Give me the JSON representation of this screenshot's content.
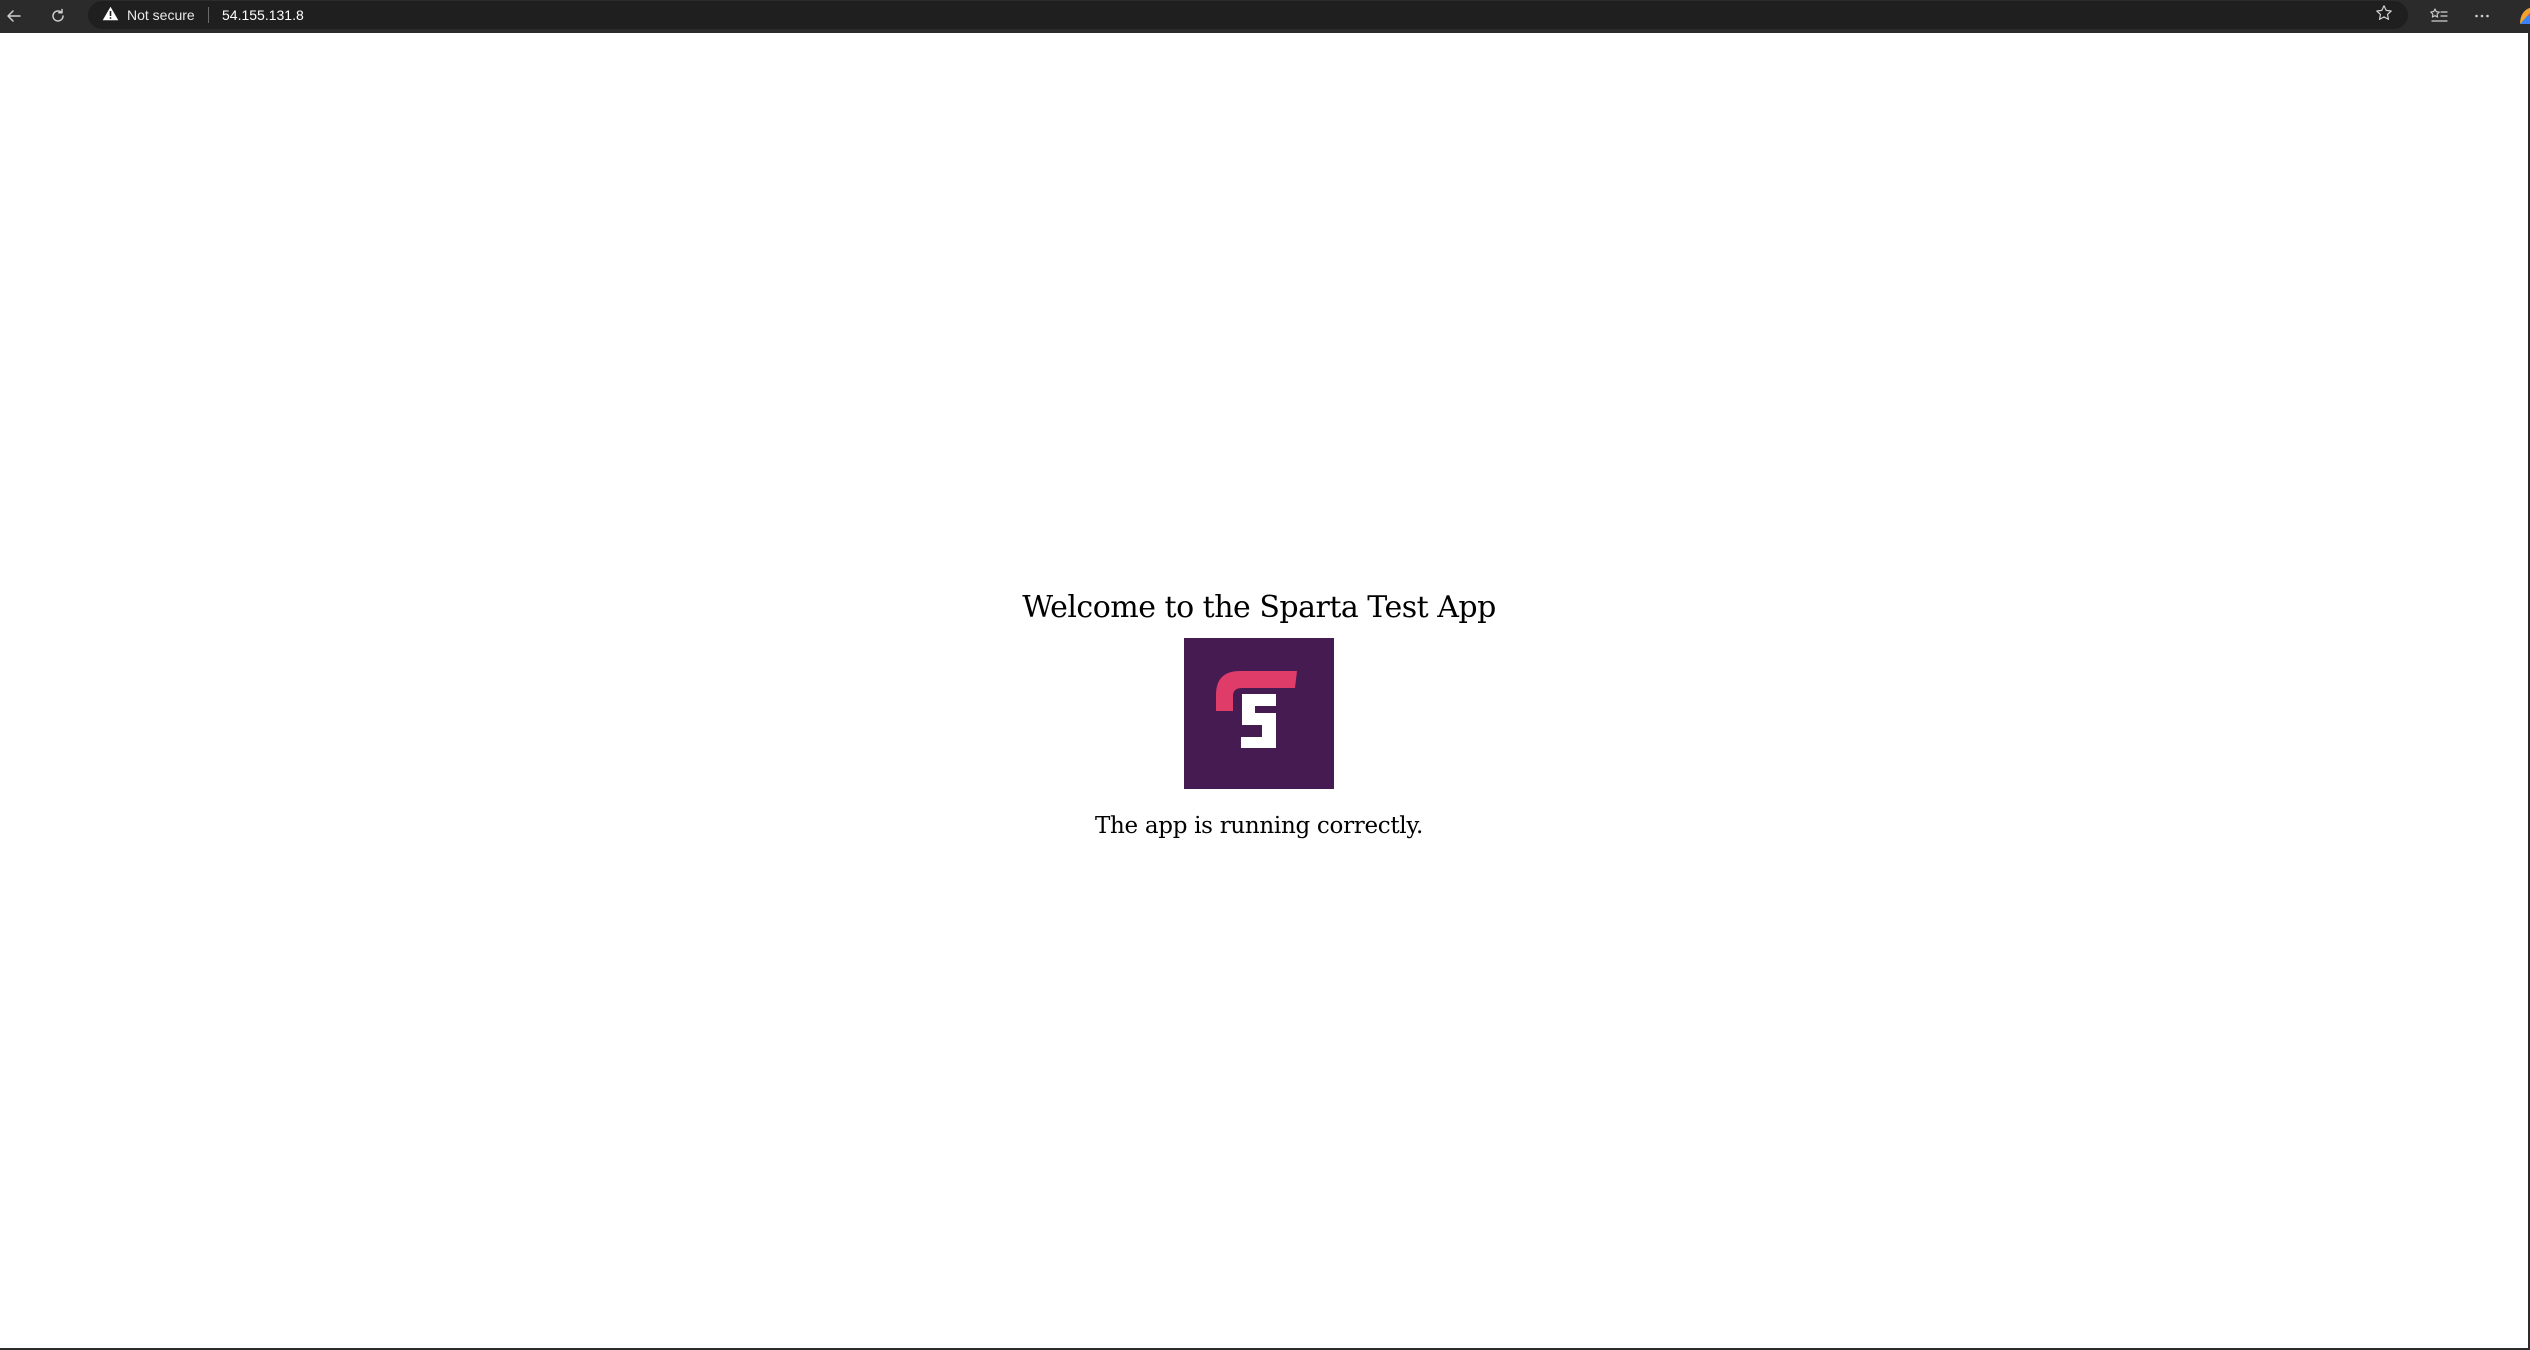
{
  "browser": {
    "security_label": "Not secure",
    "url": "54.155.131.8",
    "icons": {
      "back": "back-arrow-icon",
      "reload": "reload-icon",
      "security": "warning-icon",
      "favorite": "star-icon",
      "favorites": "favorites-list-icon",
      "menu": "more-icon"
    }
  },
  "page": {
    "heading": "Welcome to the Sparta Test App",
    "logo": {
      "background_color": "#461b52",
      "accent_color": "#e03c6a",
      "letter_color": "#ffffff"
    },
    "status_text": "The app is running correctly."
  }
}
